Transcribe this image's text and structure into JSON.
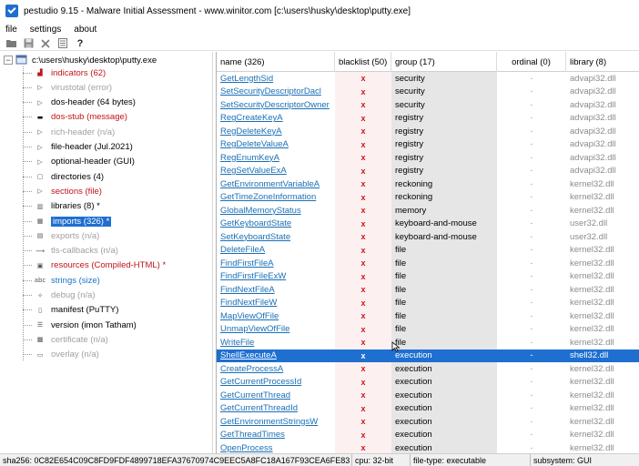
{
  "window": {
    "title": "pestudio 9.15 - Malware Initial Assessment - www.winitor.com [c:\\users\\husky\\desktop\\putty.exe]"
  },
  "menu": [
    "file",
    "settings",
    "about"
  ],
  "toolbar": [
    "open-icon",
    "save-icon",
    "close-icon",
    "list-icon",
    "help-icon"
  ],
  "tree": {
    "root": "c:\\users\\husky\\desktop\\putty.exe",
    "nodes": [
      {
        "label": "indicators (62)",
        "icon": "chart-icon",
        "color": "red"
      },
      {
        "label": "virustotal (error)",
        "icon": "virustotal-icon",
        "color": "gray"
      },
      {
        "label": "dos-header (64 bytes)",
        "icon": "play-icon",
        "color": "black"
      },
      {
        "label": "dos-stub (message)",
        "icon": "console-icon",
        "color": "red"
      },
      {
        "label": "rich-header (n/a)",
        "icon": "play-icon",
        "color": "gray"
      },
      {
        "label": "file-header (Jul.2021)",
        "icon": "play-icon",
        "color": "black"
      },
      {
        "label": "optional-header (GUI)",
        "icon": "play-icon",
        "color": "black"
      },
      {
        "label": "directories (4)",
        "icon": "folder-icon",
        "color": "black"
      },
      {
        "label": "sections (file)",
        "icon": "play-icon",
        "color": "red"
      },
      {
        "label": "libraries (8) *",
        "icon": "books-icon",
        "color": "black"
      },
      {
        "label": "imports (326) *",
        "icon": "imports-icon",
        "color": "selected"
      },
      {
        "label": "exports (n/a)",
        "icon": "exports-icon",
        "color": "gray"
      },
      {
        "label": "tls-callbacks (n/a)",
        "icon": "tls-icon",
        "color": "gray"
      },
      {
        "label": "resources (Compiled-HTML) *",
        "icon": "resources-icon",
        "color": "red"
      },
      {
        "label": "strings (size)",
        "icon": "abc-icon",
        "color": "blue"
      },
      {
        "label": "debug (n/a)",
        "icon": "debug-icon",
        "color": "gray"
      },
      {
        "label": "manifest (PuTTY)",
        "icon": "document-icon",
        "color": "black"
      },
      {
        "label": "version (imon Tatham)",
        "icon": "version-icon",
        "color": "black"
      },
      {
        "label": "certificate (n/a)",
        "icon": "certificate-icon",
        "color": "gray"
      },
      {
        "label": "overlay (n/a)",
        "icon": "overlay-icon",
        "color": "gray"
      }
    ]
  },
  "columns": [
    "name (326)",
    "blacklist (50)",
    "group (17)",
    "ordinal (0)",
    "library (8)"
  ],
  "rows": [
    {
      "name": "GetLengthSid",
      "bl": "x",
      "group": "security",
      "ord": "-",
      "lib": "advapi32.dll"
    },
    {
      "name": "SetSecurityDescriptorDacl",
      "bl": "x",
      "group": "security",
      "ord": "-",
      "lib": "advapi32.dll"
    },
    {
      "name": "SetSecurityDescriptorOwner",
      "bl": "x",
      "group": "security",
      "ord": "-",
      "lib": "advapi32.dll"
    },
    {
      "name": "RegCreateKeyA",
      "bl": "x",
      "group": "registry",
      "ord": "-",
      "lib": "advapi32.dll"
    },
    {
      "name": "RegDeleteKeyA",
      "bl": "x",
      "group": "registry",
      "ord": "-",
      "lib": "advapi32.dll"
    },
    {
      "name": "RegDeleteValueA",
      "bl": "x",
      "group": "registry",
      "ord": "-",
      "lib": "advapi32.dll"
    },
    {
      "name": "RegEnumKeyA",
      "bl": "x",
      "group": "registry",
      "ord": "-",
      "lib": "advapi32.dll"
    },
    {
      "name": "RegSetValueExA",
      "bl": "x",
      "group": "registry",
      "ord": "-",
      "lib": "advapi32.dll"
    },
    {
      "name": "GetEnvironmentVariableA",
      "bl": "x",
      "group": "reckoning",
      "ord": "-",
      "lib": "kernel32.dll"
    },
    {
      "name": "GetTimeZoneInformation",
      "bl": "x",
      "group": "reckoning",
      "ord": "-",
      "lib": "kernel32.dll"
    },
    {
      "name": "GlobalMemoryStatus",
      "bl": "x",
      "group": "memory",
      "ord": "-",
      "lib": "kernel32.dll"
    },
    {
      "name": "GetKeyboardState",
      "bl": "x",
      "group": "keyboard-and-mouse",
      "ord": "-",
      "lib": "user32.dll"
    },
    {
      "name": "SetKeyboardState",
      "bl": "x",
      "group": "keyboard-and-mouse",
      "ord": "-",
      "lib": "user32.dll"
    },
    {
      "name": "DeleteFileA",
      "bl": "x",
      "group": "file",
      "ord": "-",
      "lib": "kernel32.dll"
    },
    {
      "name": "FindFirstFileA",
      "bl": "x",
      "group": "file",
      "ord": "-",
      "lib": "kernel32.dll"
    },
    {
      "name": "FindFirstFileExW",
      "bl": "x",
      "group": "file",
      "ord": "-",
      "lib": "kernel32.dll"
    },
    {
      "name": "FindNextFileA",
      "bl": "x",
      "group": "file",
      "ord": "-",
      "lib": "kernel32.dll"
    },
    {
      "name": "FindNextFileW",
      "bl": "x",
      "group": "file",
      "ord": "-",
      "lib": "kernel32.dll"
    },
    {
      "name": "MapViewOfFile",
      "bl": "x",
      "group": "file",
      "ord": "-",
      "lib": "kernel32.dll"
    },
    {
      "name": "UnmapViewOfFile",
      "bl": "x",
      "group": "file",
      "ord": "-",
      "lib": "kernel32.dll"
    },
    {
      "name": "WriteFile",
      "bl": "x",
      "group": "file",
      "ord": "-",
      "lib": "kernel32.dll"
    },
    {
      "name": "ShellExecuteA",
      "bl": "x",
      "group": "execution",
      "ord": "-",
      "lib": "shell32.dll",
      "selected": true
    },
    {
      "name": "CreateProcessA",
      "bl": "x",
      "group": "execution",
      "ord": "-",
      "lib": "kernel32.dll"
    },
    {
      "name": "GetCurrentProcessId",
      "bl": "x",
      "group": "execution",
      "ord": "-",
      "lib": "kernel32.dll"
    },
    {
      "name": "GetCurrentThread",
      "bl": "x",
      "group": "execution",
      "ord": "-",
      "lib": "kernel32.dll"
    },
    {
      "name": "GetCurrentThreadId",
      "bl": "x",
      "group": "execution",
      "ord": "-",
      "lib": "kernel32.dll"
    },
    {
      "name": "GetEnvironmentStringsW",
      "bl": "x",
      "group": "execution",
      "ord": "-",
      "lib": "kernel32.dll"
    },
    {
      "name": "GetThreadTimes",
      "bl": "x",
      "group": "execution",
      "ord": "-",
      "lib": "kernel32.dll"
    },
    {
      "name": "OpenProcess",
      "bl": "x",
      "group": "execution",
      "ord": "-",
      "lib": "kernel32.dll"
    }
  ],
  "status": {
    "sha256": "sha256: 0C82E654C09C8FD9FDF4899718EFA37670974C9EEC5A8FC18A167F93CEA6FE83",
    "cpu": "cpu: 32-bit",
    "filetype": "file-type: executable",
    "subsystem": "subsystem: GUI"
  },
  "colors": {
    "selection": "#1e6fd0",
    "indicator_red": "#c0141a",
    "link_blue": "#1a6fb5",
    "group_bg": "#e6e6e6"
  }
}
